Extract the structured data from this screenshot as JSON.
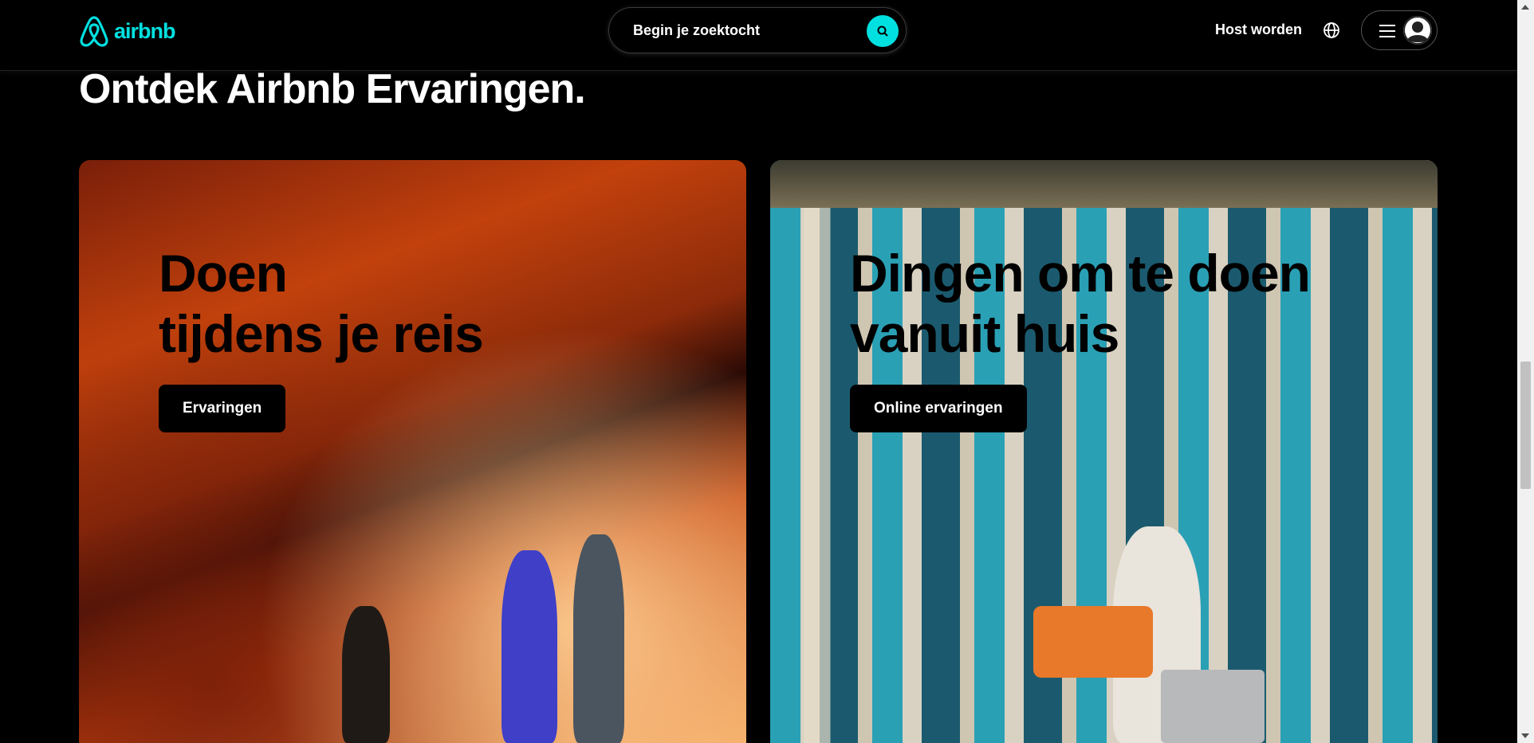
{
  "header": {
    "logo_text": "airbnb",
    "search_label": "Begin je zoektocht",
    "host_link": "Host worden",
    "accent_color": "#00e0e0",
    "icons": [
      "airbnb-logo-icon",
      "search-icon",
      "globe-icon",
      "menu-icon",
      "avatar-icon"
    ]
  },
  "main": {
    "title": "Ontdek Airbnb Ervaringen.",
    "cards": [
      {
        "heading_line1": "Doen",
        "heading_line2": "tijdens je reis",
        "button": "Ervaringen"
      },
      {
        "heading_line1": "Dingen om te doen",
        "heading_line2": "vanuit huis",
        "button": "Online ervaringen"
      }
    ]
  }
}
